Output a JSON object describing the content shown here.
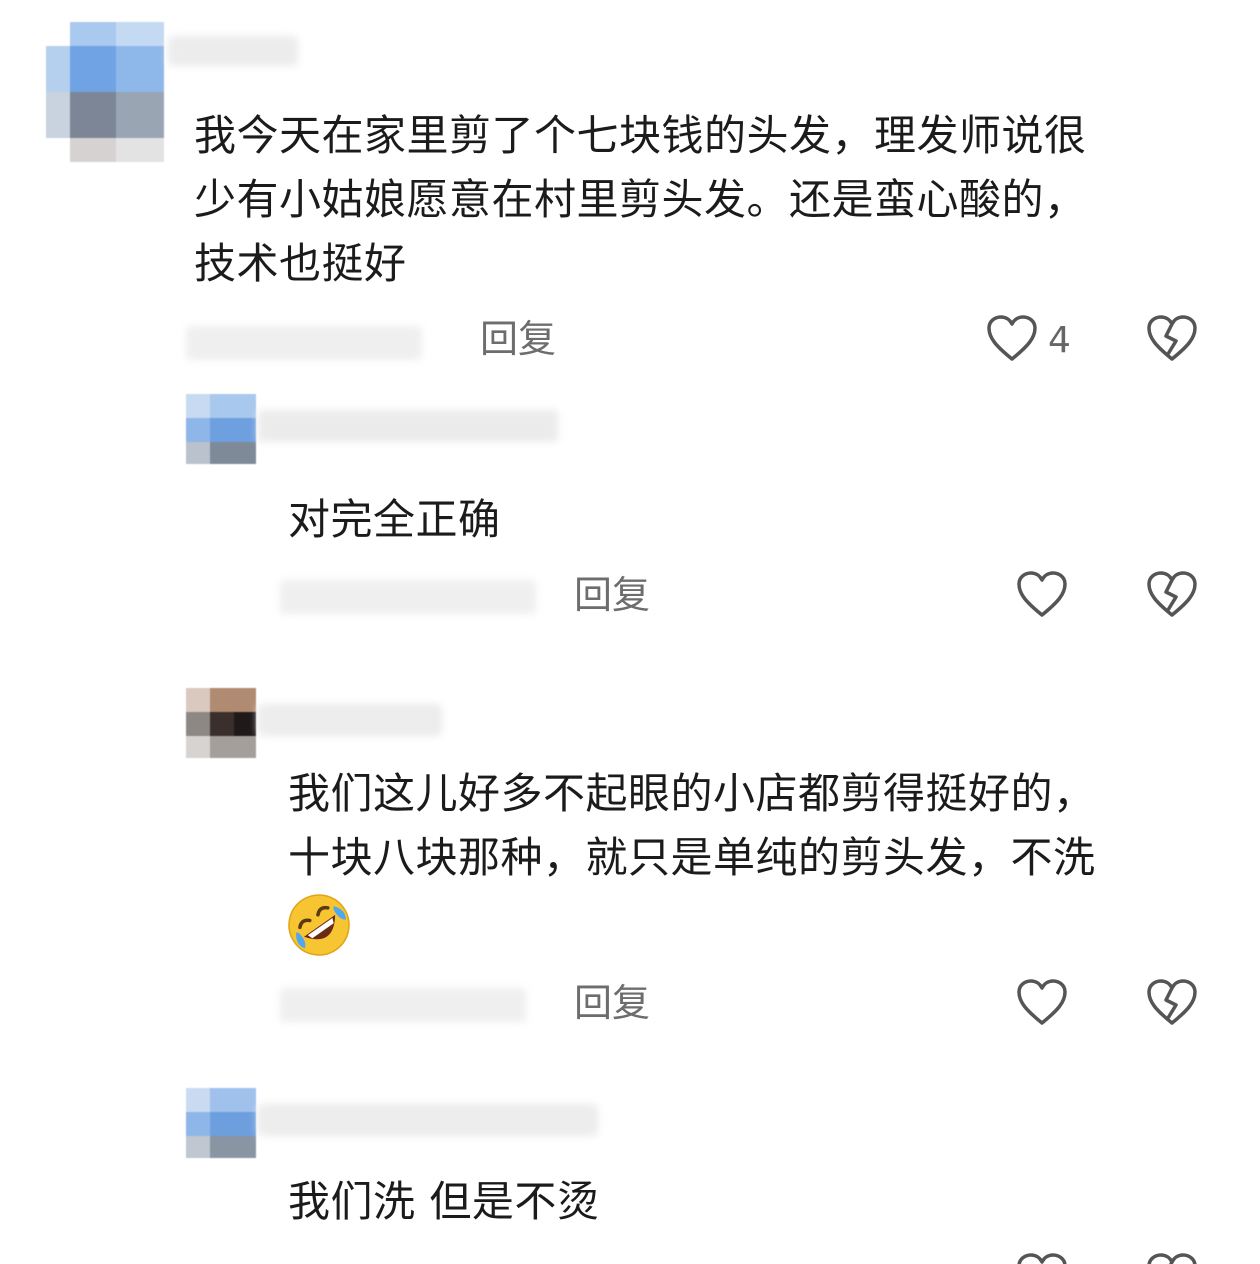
{
  "comments": [
    {
      "text": "我今天在家里剪了个七块钱的头发，理发师说很\n少有小姑娘愿意在村里剪头发。还是蛮心酸的，\n技术也挺好",
      "reply_label": "回复",
      "like_count": "4"
    },
    {
      "text": "对完全正确",
      "reply_label": "回复",
      "like_count": ""
    },
    {
      "text": "我们这儿好多不起眼的小店都剪得挺好的，\n十块八块那种，就只是单纯的剪头发，不洗",
      "emoji": "rolling-on-floor-laughing",
      "reply_label": "回复",
      "like_count": ""
    },
    {
      "text": "我们洗 但是不烫",
      "reply_label": "",
      "like_count": ""
    }
  ],
  "icons": {
    "like": "heart-outline-icon",
    "dislike": "broken-heart-icon"
  },
  "colors": {
    "text": "#1b1b1b",
    "secondary": "#6d6d6d",
    "icon": "#555555",
    "background": "#ffffff"
  }
}
